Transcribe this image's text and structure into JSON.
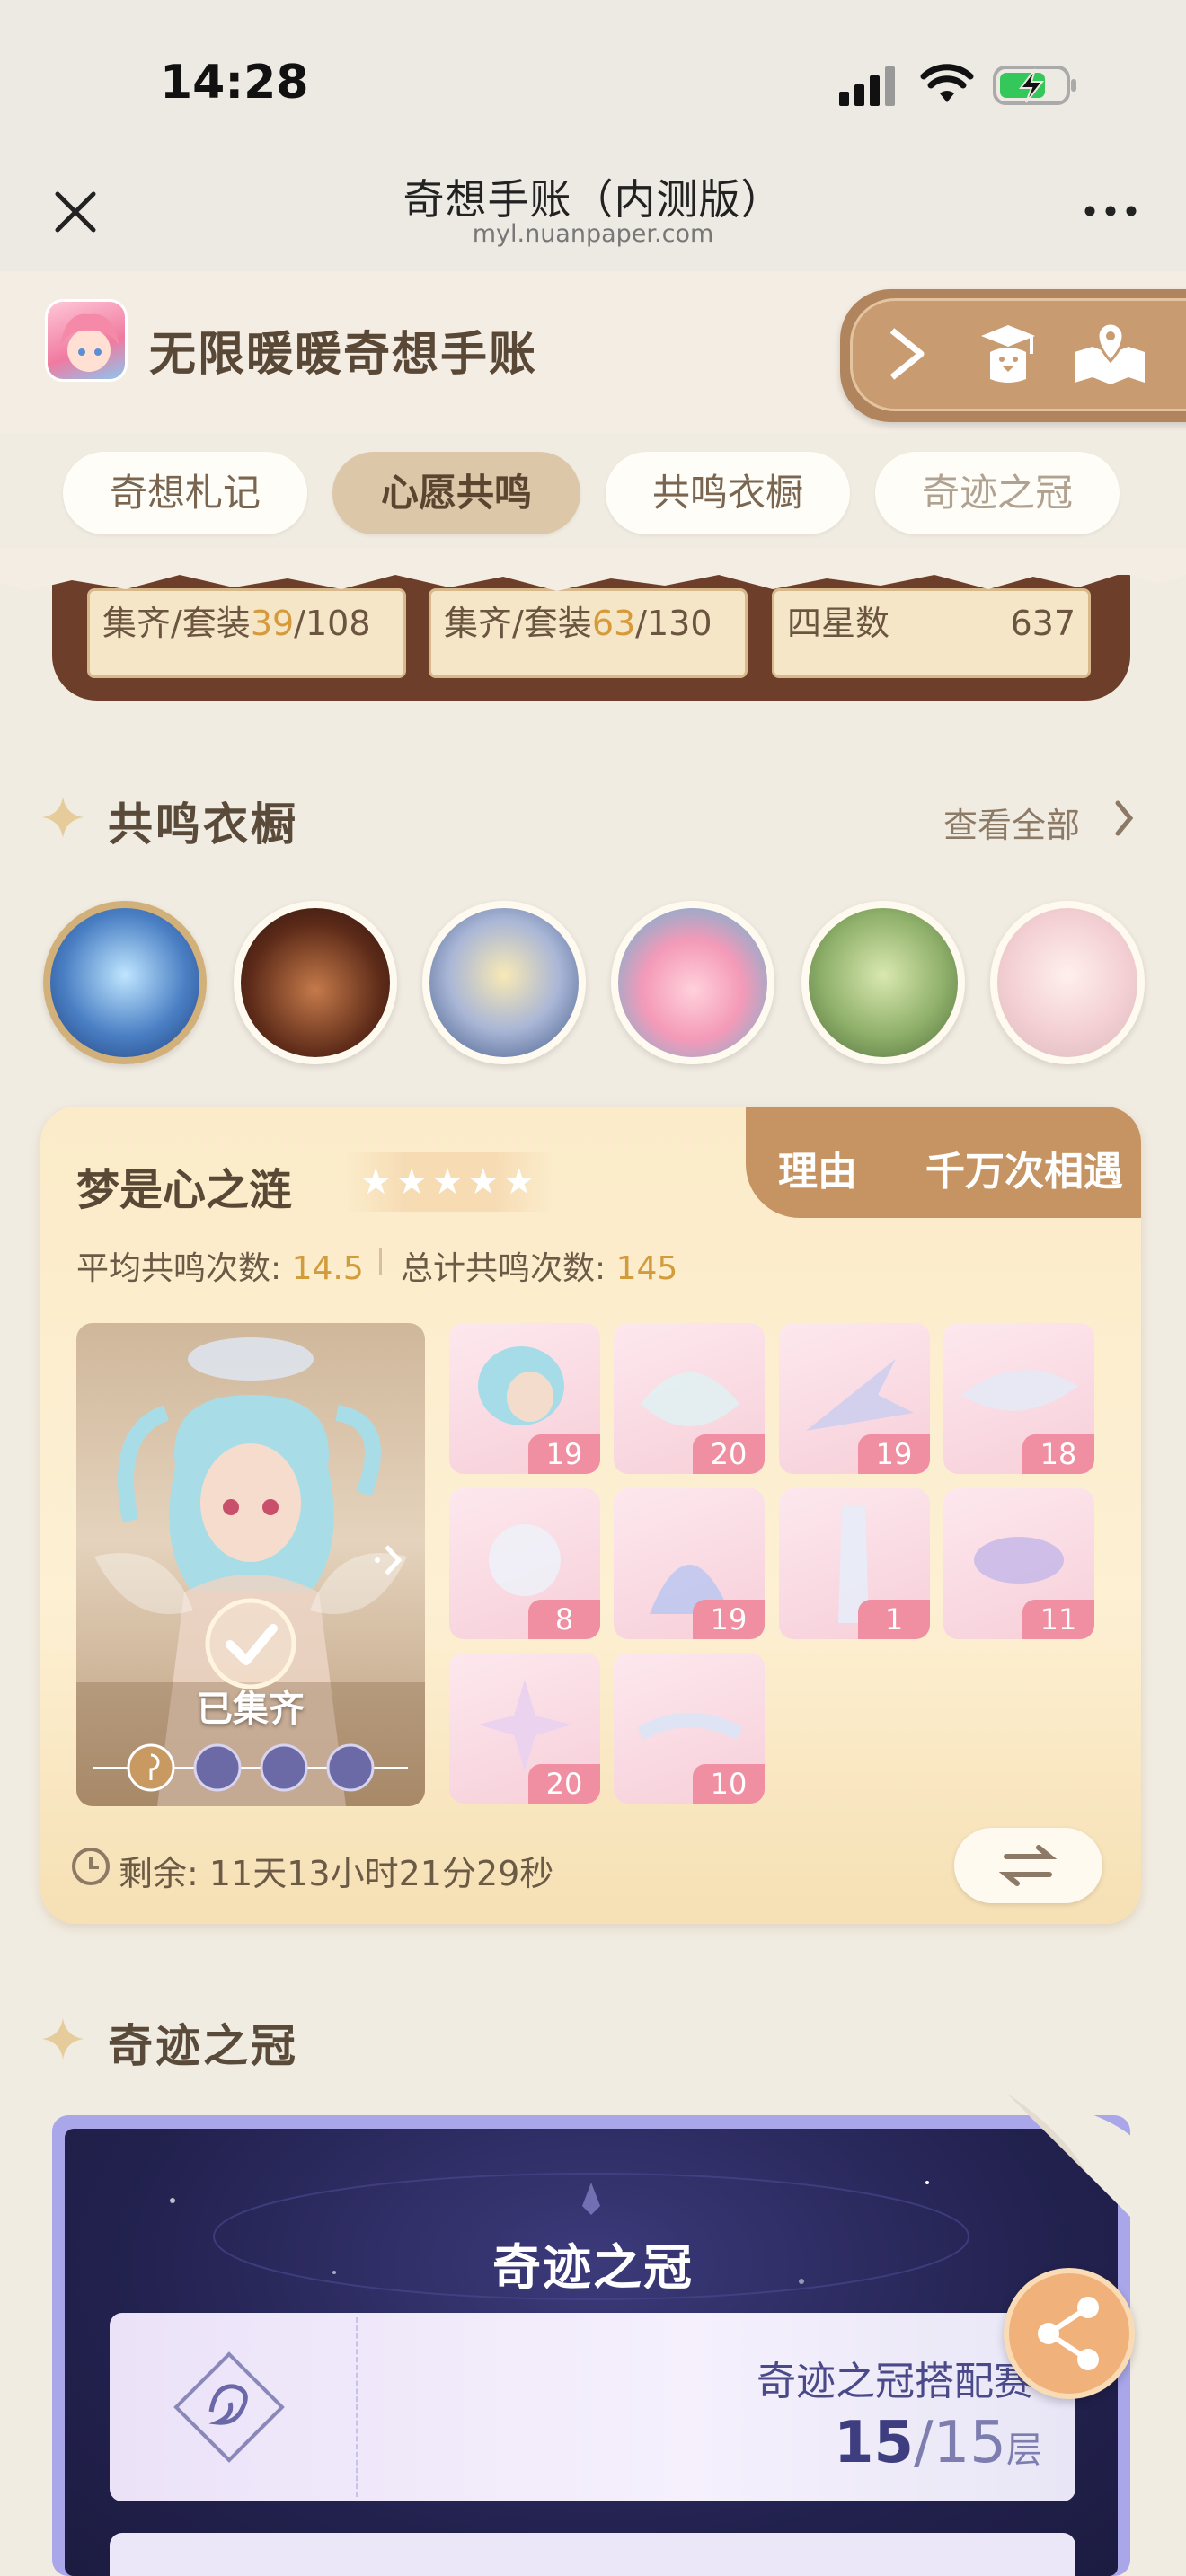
{
  "status_bar": {
    "time": "14:28"
  },
  "nav": {
    "title": "奇想手账（内测版）",
    "url": "myl.nuanpaper.com",
    "more": "..."
  },
  "app": {
    "name": "无限暖暖奇想手账"
  },
  "tabs": [
    {
      "label": "奇想札记"
    },
    {
      "label": "心愿共鸣"
    },
    {
      "label": "共鸣衣橱"
    },
    {
      "label": "奇迹之冠"
    }
  ],
  "stats": [
    {
      "prefix": "集齐/套装",
      "value": "39",
      "total": "/108"
    },
    {
      "prefix": "集齐/套装",
      "value": "63",
      "total": "/130"
    },
    {
      "prefix": "四星数",
      "value": "637",
      "total": ""
    }
  ],
  "wardrobe": {
    "title": "共鸣衣橱",
    "view_all": "查看全部"
  },
  "outfit": {
    "name": "梦是心之涟",
    "stars": "★★★★★",
    "tabs": [
      "理由",
      "千万次相遇"
    ],
    "avg_label": "平均共鸣次数:",
    "avg_value": "14.5",
    "total_label": "总计共鸣次数:",
    "total_value": "145",
    "collected": "已集齐",
    "items": [
      "19",
      "20",
      "19",
      "18",
      "8",
      "19",
      "1",
      "11",
      "20",
      "10"
    ],
    "timer": "剩余: 11天13小时21分29秒"
  },
  "crown": {
    "section_title": "奇迹之冠",
    "panel_title": "奇迹之冠",
    "ticket_label": "奇迹之冠搭配赛",
    "progress_value": "15",
    "progress_total": "/15",
    "progress_unit": "层"
  },
  "colors": {
    "accent": "#d69a3a",
    "brown": "#6d3f2a",
    "pink_badge": "#ef8fa1",
    "share": "#f0b27a"
  }
}
